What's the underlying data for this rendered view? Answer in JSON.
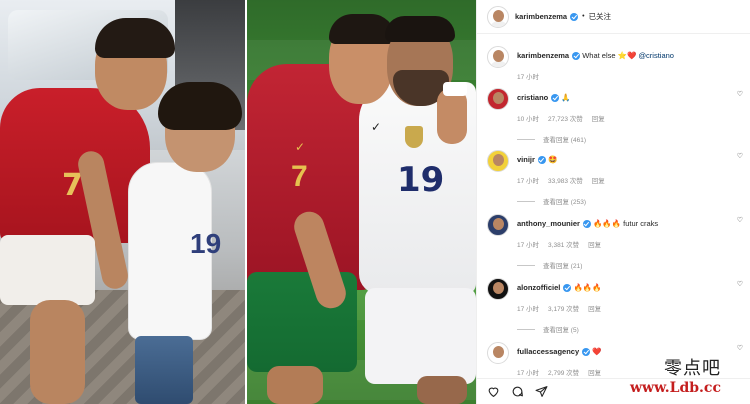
{
  "post": {
    "author": "karimbenzema",
    "follow_label": "已关注",
    "caption": "What else",
    "caption_emoji": "⭐❤️",
    "caption_mention": "@cristiano",
    "caption_time": "17 小时"
  },
  "comments": [
    {
      "user": "cristiano",
      "text": "🙏",
      "time": "10 小时",
      "likes": "27,723 次赞",
      "reply": "回复",
      "replies": "查看回复 (461)",
      "avatar_color": "#c2262f"
    },
    {
      "user": "vinijr",
      "text": "🤩",
      "time": "17 小时",
      "likes": "33,983 次赞",
      "reply": "回复",
      "replies": "查看回复 (253)",
      "avatar_color": "#f2d13a"
    },
    {
      "user": "anthony_mounier",
      "text": "🔥🔥🔥 futur craks",
      "time": "17 小时",
      "likes": "3,381 次赞",
      "reply": "回复",
      "replies": "查看回复 (21)",
      "avatar_color": "#2c3e6a"
    },
    {
      "user": "alonzofficiel",
      "text": "🔥🔥🔥",
      "time": "17 小时",
      "likes": "3,179 次赞",
      "reply": "回复",
      "replies": "查看回复 (5)",
      "avatar_color": "#111111"
    },
    {
      "user": "fullaccessagency",
      "text": "❤️",
      "time": "17 小时",
      "likes": "2,799 次赞",
      "reply": "回复",
      "replies": "",
      "avatar_color": "#ffffff"
    }
  ],
  "actions": [
    "heart-icon",
    "comment-icon",
    "share-icon"
  ],
  "watermark": {
    "cn": "零点吧",
    "url": "www.Ldb.cc"
  },
  "photo_left": {
    "kid2_number": "19",
    "kid1_number": "7"
  },
  "photo_right": {
    "cr_number": "7",
    "kb_number": "19"
  }
}
